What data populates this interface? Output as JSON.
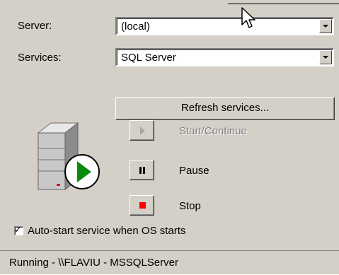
{
  "form": {
    "server_label": "Server:",
    "server_value": "(local)",
    "services_label": "Services:",
    "services_value": "SQL Server",
    "refresh_button": "Refresh services..."
  },
  "actions": {
    "start": "Start/Continue",
    "pause": "Pause",
    "stop": "Stop"
  },
  "autostart": {
    "label": "Auto-start service when OS starts",
    "checked": true
  },
  "status_bar": {
    "text": "Running - \\\\FLAVIU - MSSQLServer"
  },
  "colors": {
    "panel": "#d4d0c8",
    "stop_red": "#ff0000",
    "run_green": "#008a00"
  }
}
